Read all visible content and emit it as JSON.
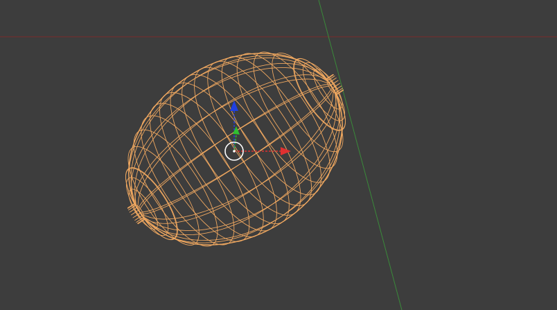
{
  "viewport": {
    "background": "#3d3d3d",
    "axis_x_color": "#7a2a2a",
    "axis_y_color": "#3a8a3a"
  },
  "object": {
    "name": "lemon-mesh",
    "shading": "wireframe",
    "wire_color": "#f0a860",
    "selected": true
  },
  "gizmo": {
    "x_color": "#e03030",
    "y_color": "#30c030",
    "z_color": "#2040e0",
    "origin_ring_color": "#ffffff"
  }
}
